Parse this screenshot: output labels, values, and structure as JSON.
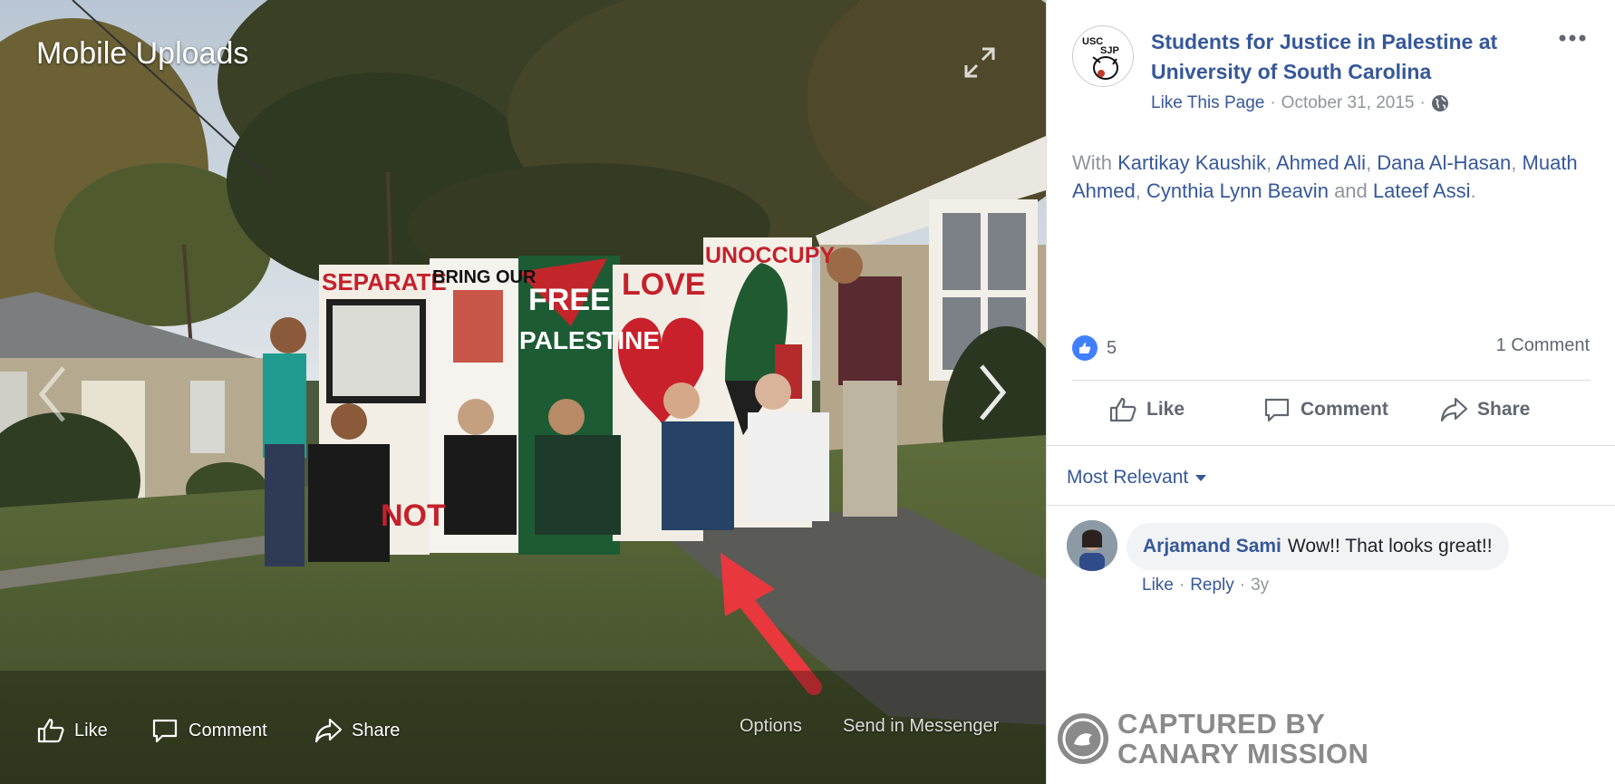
{
  "viewer": {
    "album_title": "Mobile Uploads",
    "actions": {
      "like": "Like",
      "comment": "Comment",
      "share": "Share",
      "options": "Options",
      "send": "Send in Messenger"
    },
    "boards": {
      "separate": "SEPARATE",
      "bring_our": "BRING OUR",
      "free_palestine_1": "FREE",
      "free_palestine_2": "PALESTINE",
      "love": "LOVE",
      "unoccupy": "UNOCCUPY",
      "not": "NOT"
    }
  },
  "post": {
    "page_name": "Students for Justice in Palestine at University of South Carolina",
    "like_page": "Like This Page",
    "date": "October 31, 2015",
    "with_prefix": "With",
    "with_people": [
      "Kartikay Kaushik",
      "Ahmed Ali",
      "Dana Al-Hasan",
      "Muath Ahmed",
      "Cynthia Lynn Beavin",
      "Lateef Assi"
    ],
    "with_and": "and",
    "reactions_count": "5",
    "comments_count": "1 Comment",
    "actions": {
      "like": "Like",
      "comment": "Comment",
      "share": "Share"
    },
    "sort_label": "Most Relevant",
    "comment": {
      "author": "Arjamand Sami",
      "text": "Wow!! That looks great!!",
      "like": "Like",
      "reply": "Reply",
      "age": "3y"
    },
    "avatar_text": "USC SJP"
  },
  "watermark": {
    "line1": "CAPTURED BY",
    "line2": "CANARY MISSION"
  },
  "colors": {
    "link": "#365899",
    "muted": "#90949c",
    "like_badge": "#4080ff",
    "arrow": "#e8383d"
  }
}
